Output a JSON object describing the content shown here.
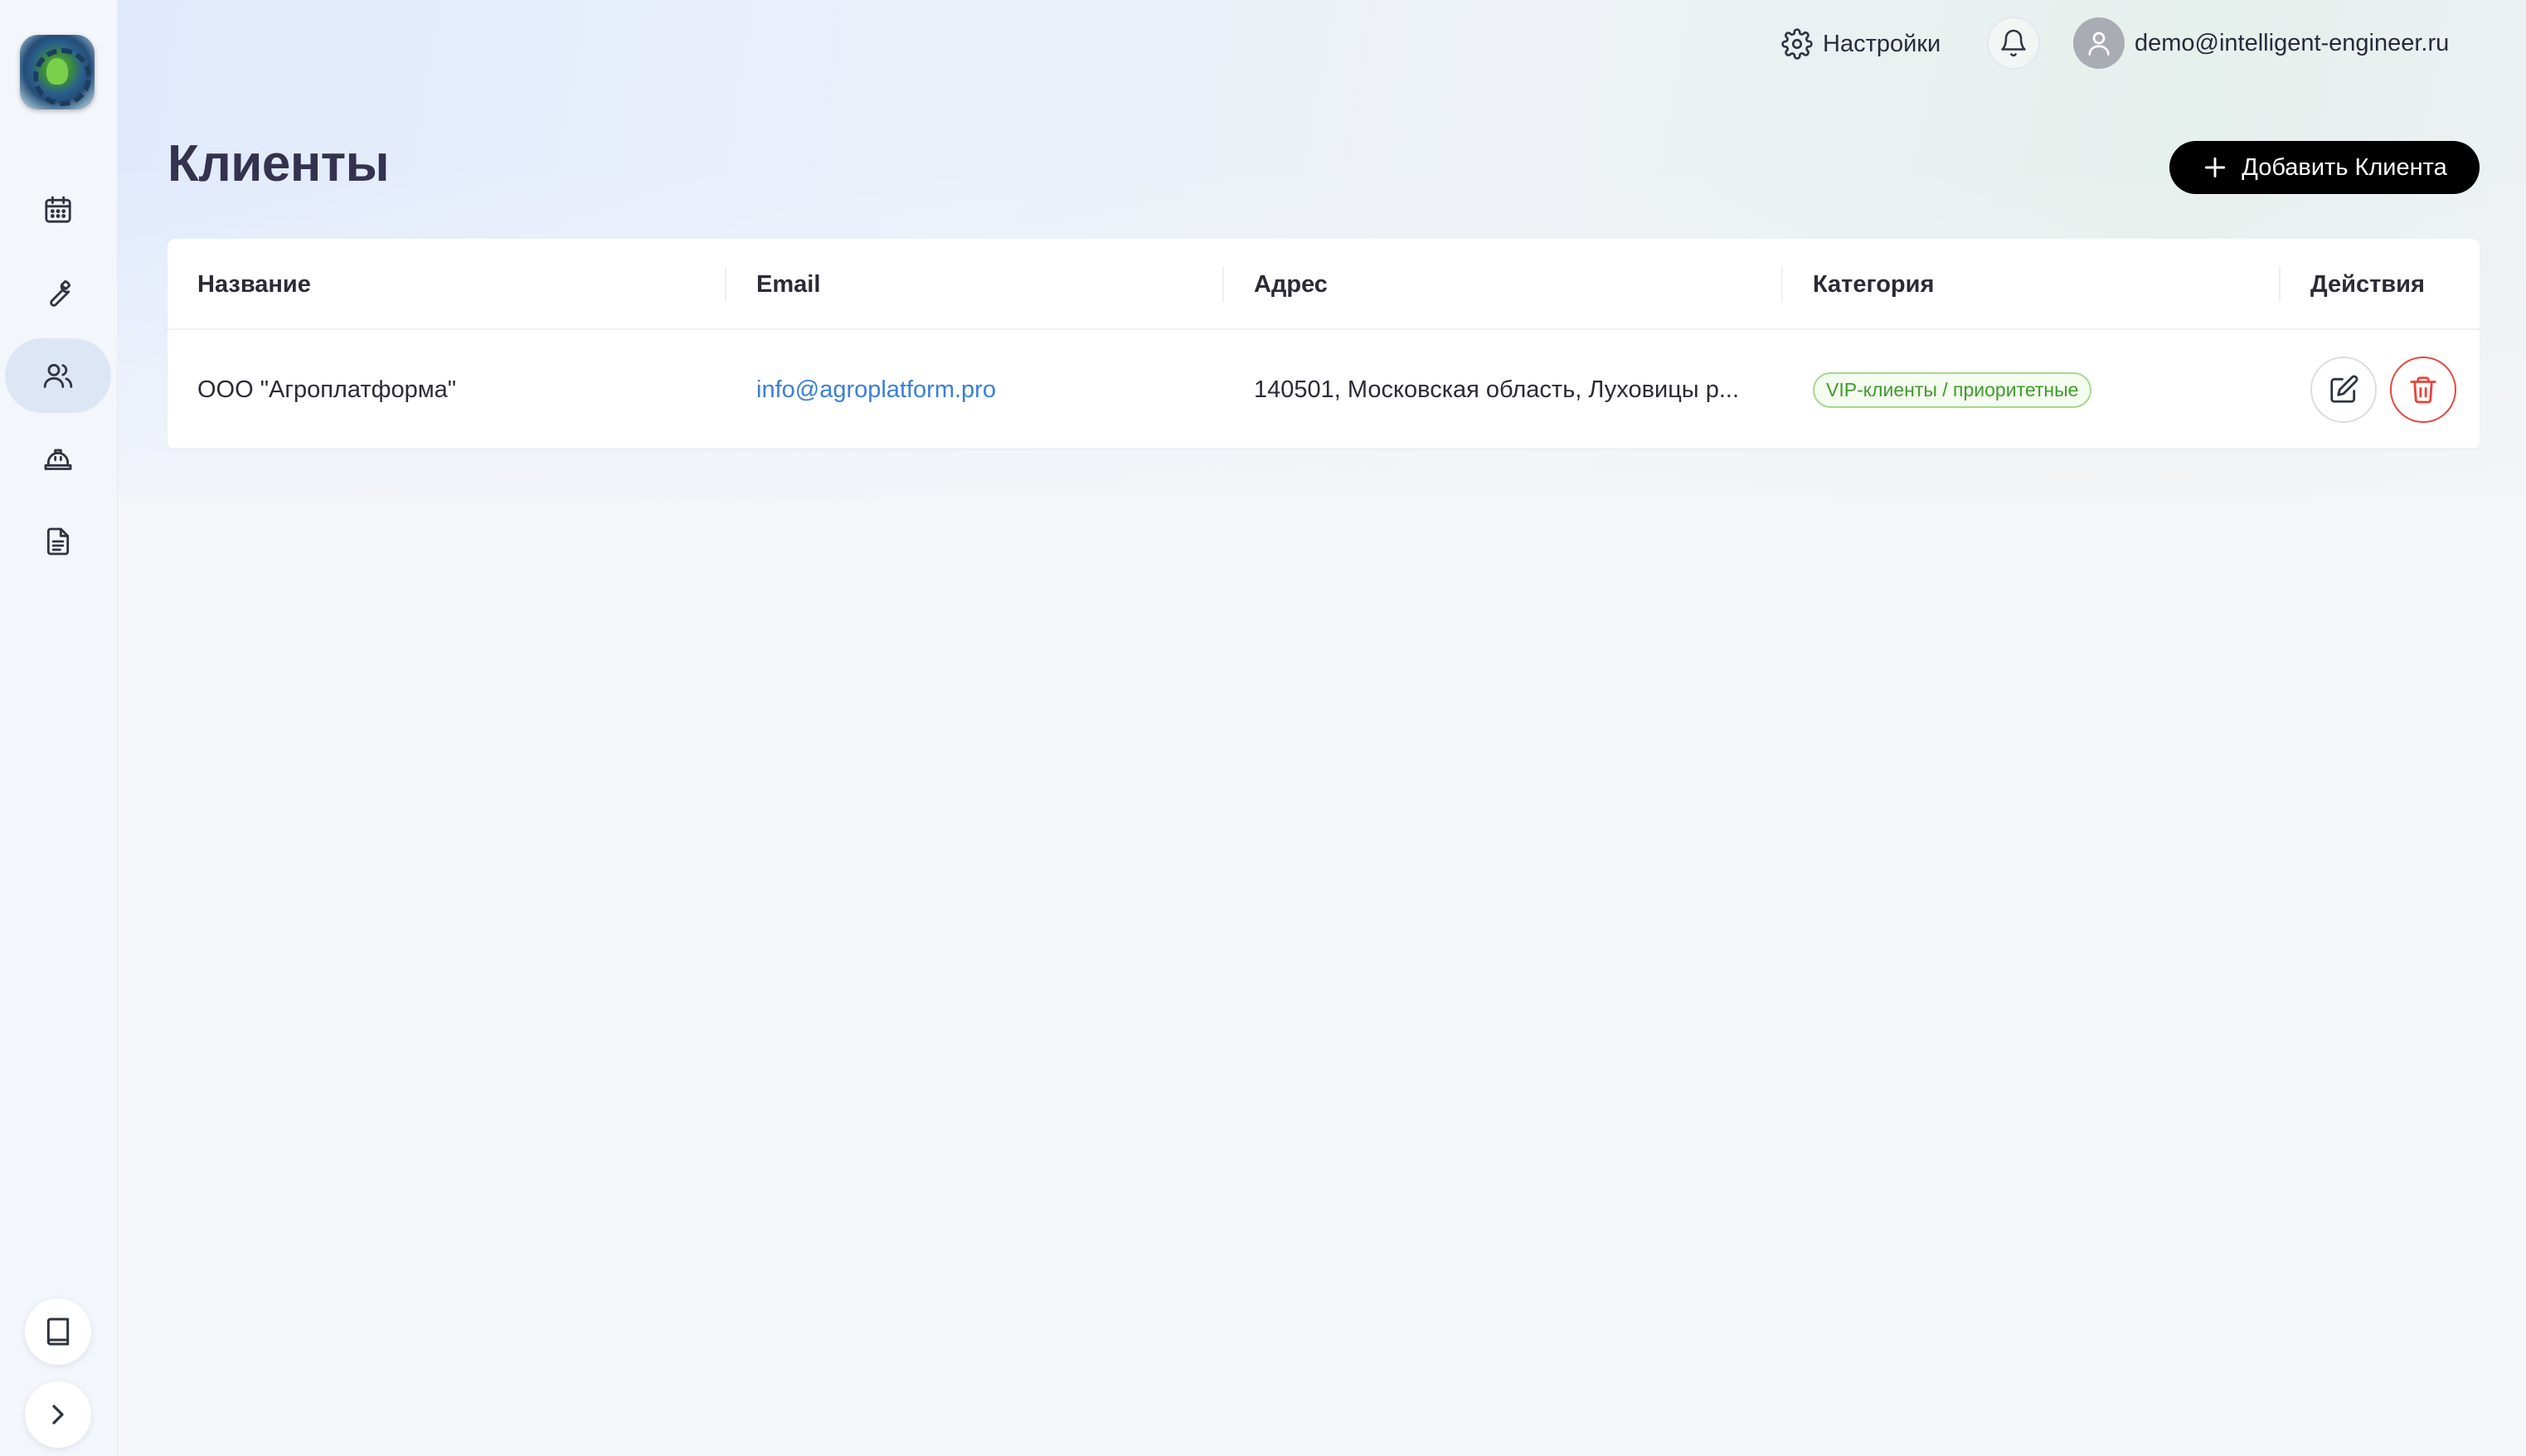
{
  "header": {
    "settings_label": "Настройки",
    "user_email": "demo@intelligent-engineer.ru"
  },
  "sidebar": {
    "items": [
      {
        "icon": "calendar-icon"
      },
      {
        "icon": "wrench-icon"
      },
      {
        "icon": "users-icon",
        "active": true
      },
      {
        "icon": "hard-hat-icon"
      },
      {
        "icon": "document-icon"
      }
    ],
    "bottom": [
      {
        "icon": "book-icon"
      },
      {
        "icon": "chevron-right-icon"
      }
    ]
  },
  "page": {
    "title": "Клиенты",
    "add_button_label": "Добавить Клиента"
  },
  "table": {
    "columns": [
      "Название",
      "Email",
      "Адрес",
      "Категория",
      "Действия"
    ],
    "rows": [
      {
        "name": "ООО \"Агроплатформа\"",
        "email": "info@agroplatform.pro",
        "address": "140501, Московская область, Луховицы р...",
        "category": "VIP-клиенты / приоритетные"
      }
    ]
  },
  "colors": {
    "accent": "#000000",
    "link": "#3a7fd8",
    "badge_green": "#3f9b2a",
    "delete_red": "#e8443b"
  }
}
